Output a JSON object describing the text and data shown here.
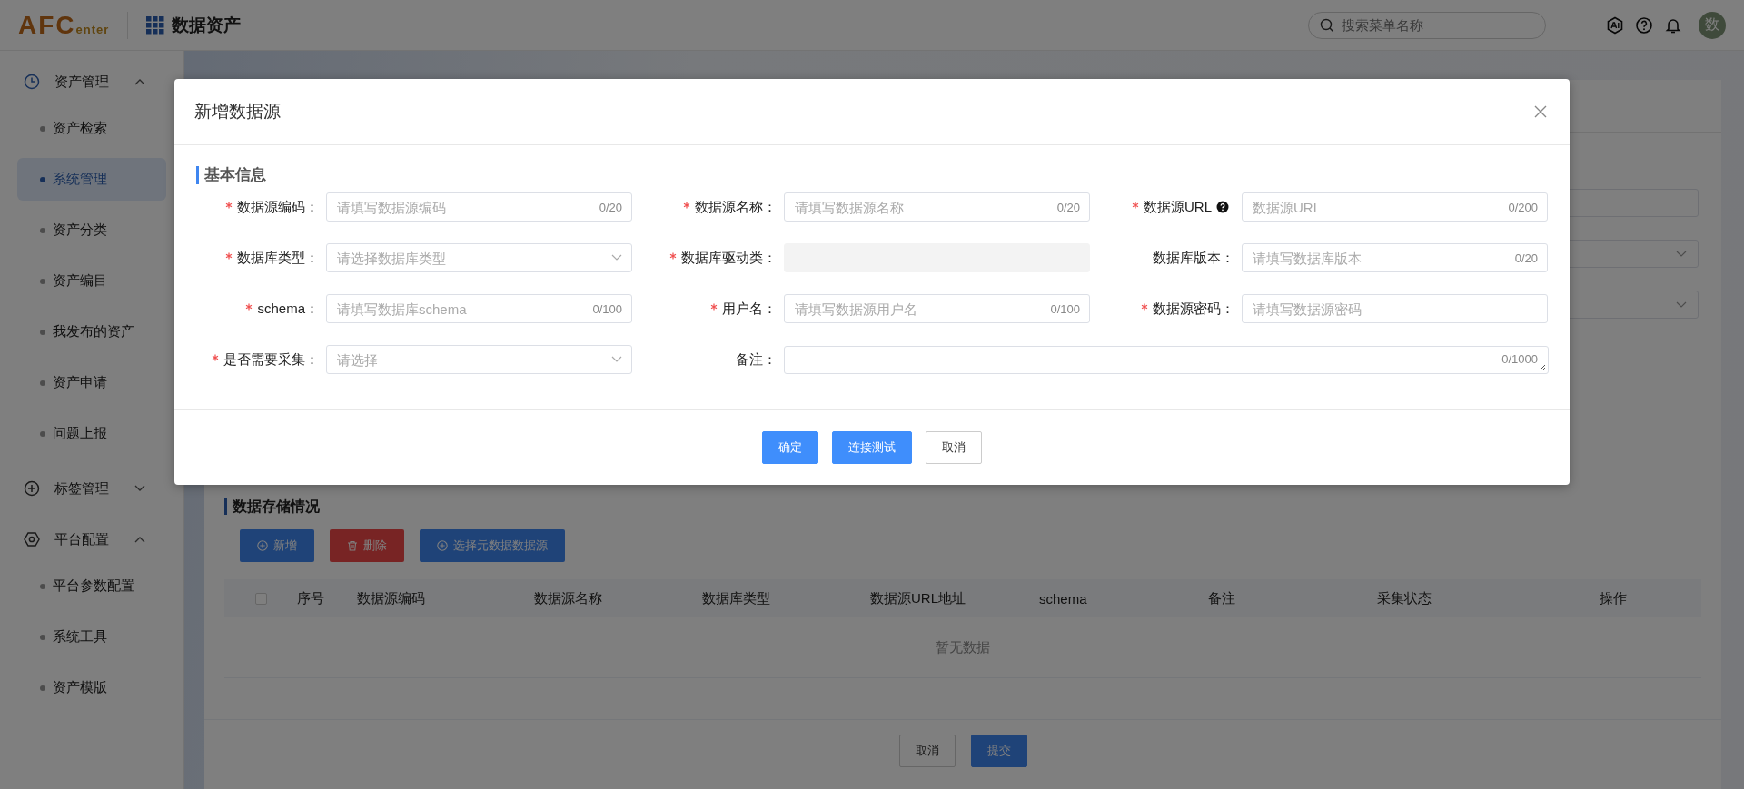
{
  "header": {
    "logo": {
      "main": "AFC",
      "sub": "enter"
    },
    "app_title": "数据资产",
    "search": {
      "placeholder": "搜索菜单名称"
    },
    "avatar": "数"
  },
  "sidebar": {
    "groups": [
      {
        "label": "资产管理",
        "expanded": true,
        "children": [
          {
            "label": "资产检索",
            "selected": false
          },
          {
            "label": "系统管理",
            "selected": true
          },
          {
            "label": "资产分类",
            "selected": false
          },
          {
            "label": "资产编目",
            "selected": false
          },
          {
            "label": "我发布的资产",
            "selected": false
          },
          {
            "label": "资产申请",
            "selected": false
          },
          {
            "label": "问题上报",
            "selected": false
          }
        ]
      },
      {
        "label": "标签管理",
        "expanded": false
      },
      {
        "label": "平台配置",
        "expanded": true,
        "children": [
          {
            "label": "平台参数配置",
            "selected": false
          },
          {
            "label": "系统工具",
            "selected": false
          },
          {
            "label": "资产模版",
            "selected": false
          }
        ]
      }
    ]
  },
  "page": {
    "section_title": "数据存储情况",
    "toolbar": [
      {
        "label": "新增",
        "kind": "add"
      },
      {
        "label": "删除",
        "kind": "delete"
      },
      {
        "label": "选择元数据数据源",
        "kind": "add"
      }
    ],
    "table": {
      "select_all": {
        "checked": false
      },
      "columns": [
        "序号",
        "数据源编码",
        "数据源名称",
        "数据库类型",
        "数据源URL地址",
        "schema",
        "备注",
        "采集状态",
        "操作"
      ],
      "empty_text": "暂无数据"
    },
    "footer_buttons": [
      {
        "label": "取消",
        "kind": "default"
      },
      {
        "label": "提交",
        "kind": "primary"
      }
    ]
  },
  "modal": {
    "title": "新增数据源",
    "section_title": "基本信息",
    "fields": [
      {
        "label": "数据源编码：",
        "required": true,
        "help": false,
        "kind": "input",
        "placeholder": "请填写数据源编码",
        "counter": "0/20"
      },
      {
        "label": "数据源名称：",
        "required": true,
        "help": false,
        "kind": "input",
        "placeholder": "请填写数据源名称",
        "counter": "0/20"
      },
      {
        "label": "数据源URL",
        "required": true,
        "help": true,
        "kind": "input",
        "placeholder": "数据源URL",
        "counter": "0/200"
      },
      {
        "label": "数据库类型：",
        "required": true,
        "help": false,
        "kind": "select",
        "placeholder": "请选择数据库类型"
      },
      {
        "label": "数据库驱动类：",
        "required": true,
        "help": false,
        "kind": "disabled"
      },
      {
        "label": "数据库版本：",
        "required": false,
        "help": false,
        "kind": "input",
        "placeholder": "请填写数据库版本",
        "counter": "0/20"
      },
      {
        "label": "schema：",
        "required": true,
        "help": false,
        "kind": "input",
        "placeholder": "请填写数据库schema",
        "counter": "0/100"
      },
      {
        "label": "用户名：",
        "required": true,
        "help": false,
        "kind": "input",
        "placeholder": "请填写数据源用户名",
        "counter": "0/100"
      },
      {
        "label": "数据源密码：",
        "required": true,
        "help": false,
        "kind": "input",
        "placeholder": "请填写数据源密码"
      },
      {
        "label": "是否需要采集：",
        "required": true,
        "help": false,
        "kind": "select",
        "placeholder": "请选择"
      },
      {
        "label": "备注：",
        "required": false,
        "help": false,
        "kind": "textarea",
        "counter": "0/1000"
      }
    ],
    "buttons": [
      {
        "label": "确定",
        "kind": "primary"
      },
      {
        "label": "连接测试",
        "kind": "primary"
      },
      {
        "label": "取消",
        "kind": "default"
      }
    ]
  }
}
